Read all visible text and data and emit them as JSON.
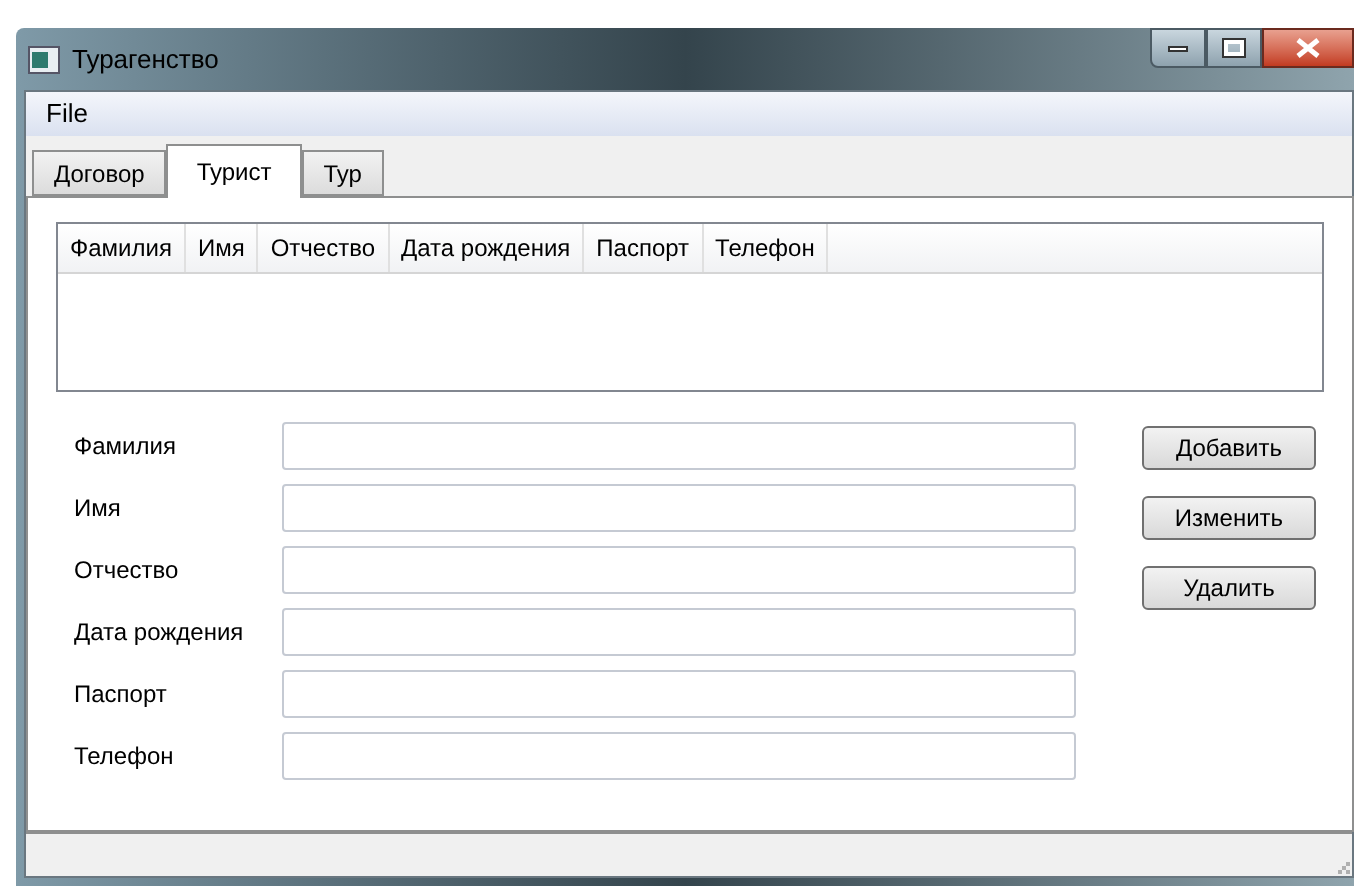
{
  "window": {
    "title": "Турагенство"
  },
  "menu": [
    "File"
  ],
  "tabs": [
    {
      "label": "Договор",
      "selected": false
    },
    {
      "label": "Турист",
      "selected": true
    },
    {
      "label": "Тур",
      "selected": false
    }
  ],
  "table": {
    "columns": [
      "Фамилия",
      "Имя",
      "Отчество",
      "Дата рождения",
      "Паспорт",
      "Телефон"
    ]
  },
  "form": {
    "fields": [
      {
        "label": "Фамилия"
      },
      {
        "label": "Имя"
      },
      {
        "label": "Отчество"
      },
      {
        "label": "Дата рождения"
      },
      {
        "label": "Паспорт"
      },
      {
        "label": "Телефон"
      }
    ]
  },
  "buttons": [
    "Добавить",
    "Изменить",
    "Удалить"
  ]
}
